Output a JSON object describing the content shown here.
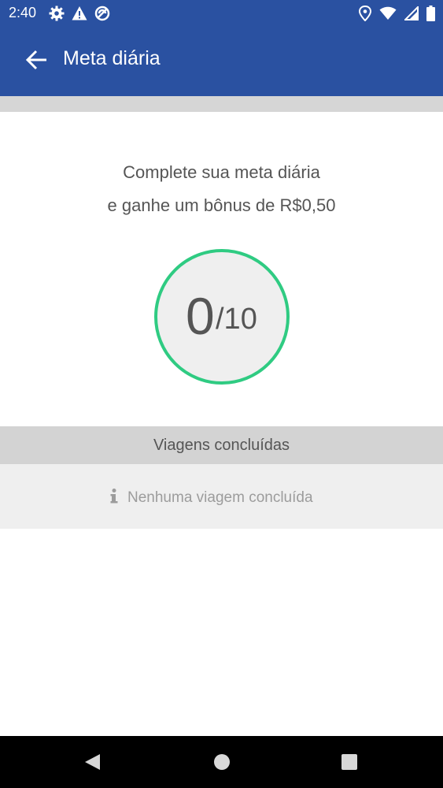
{
  "status_bar": {
    "time": "2:40",
    "left_icons": [
      "gear-icon",
      "warning-icon",
      "sync-icon"
    ],
    "right_icons": [
      "location-icon",
      "wifi-icon",
      "signal-icon",
      "battery-icon"
    ]
  },
  "app_bar": {
    "title": "Meta diária",
    "background_color": "#2a51a1",
    "back_icon": "arrow-left-icon"
  },
  "goal": {
    "description_line1": "Complete sua meta diária",
    "description_line2": "e ganhe um bônus de R$0,50",
    "completed": "0",
    "total": "/10",
    "ring_color": "#2fcb82"
  },
  "trips": {
    "header": "Viagens concluídas",
    "empty_message": "Nenhuma viagem concluída",
    "empty_icon": "info-icon"
  },
  "nav_bar": {
    "buttons": [
      "back-triangle-icon",
      "home-circle-icon",
      "recents-square-icon"
    ]
  }
}
